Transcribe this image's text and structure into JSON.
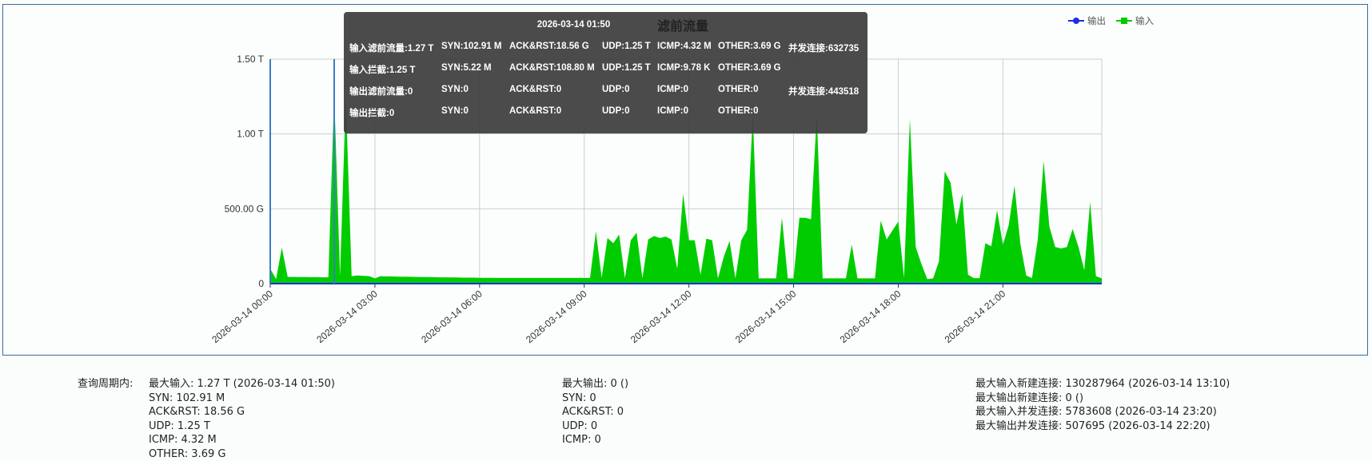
{
  "chart_data": {
    "type": "area",
    "title": "滤前流量",
    "x_start": "2026-03-14 00:00",
    "x_interval_minutes": 10,
    "x_tick_labels": [
      "2026-03-14 00:00",
      "2026-03-14 03:00",
      "2026-03-14 06:00",
      "2026-03-14 09:00",
      "2026-03-14 12:00",
      "2026-03-14 15:00",
      "2026-03-14 18:00",
      "2026-03-14 21:00"
    ],
    "y_unit": "G",
    "y_tick_values": [
      0,
      500,
      1000,
      1500
    ],
    "y_tick_labels": [
      "0",
      "500.00 G",
      "1.00 T",
      "1.50 T"
    ],
    "ylim": [
      0,
      1500
    ],
    "grid": true,
    "legend_position": "top-right",
    "series": [
      {
        "name": "输出",
        "color": "#1f2fe0",
        "marker": "circle",
        "values": "all zero"
      },
      {
        "name": "输入",
        "color": "#00cc00",
        "marker": "square",
        "values": [
          100,
          30,
          240,
          45,
          45,
          44,
          44,
          43,
          43,
          42,
          42,
          1270,
          50,
          1250,
          50,
          55,
          52,
          50,
          35,
          50,
          48,
          48,
          47,
          46,
          46,
          45,
          44,
          44,
          43,
          42,
          42,
          41,
          41,
          40,
          40,
          40,
          39,
          39,
          39,
          38,
          38,
          38,
          38,
          38,
          38,
          38,
          38,
          38,
          38,
          38,
          38,
          38,
          38,
          38,
          38,
          38,
          350,
          40,
          305,
          270,
          328,
          37,
          290,
          340,
          37,
          295,
          318,
          305,
          315,
          295,
          100,
          600,
          290,
          290,
          60,
          300,
          290,
          35,
          180,
          285,
          35,
          290,
          360,
          1130,
          35,
          35,
          35,
          35,
          440,
          35,
          35,
          440,
          440,
          430,
          1130,
          35,
          35,
          35,
          35,
          35,
          260,
          35,
          35,
          35,
          35,
          420,
          295,
          355,
          415,
          40,
          1100,
          245,
          130,
          30,
          35,
          150,
          750,
          675,
          395,
          600,
          60,
          37,
          37,
          270,
          250,
          490,
          260,
          390,
          655,
          265,
          55,
          37,
          295,
          820,
          380,
          245,
          235,
          245,
          365,
          245,
          90,
          545,
          50,
          35
        ]
      }
    ],
    "hover_index": 11
  },
  "legend": {
    "output": "输出",
    "input": "输入"
  },
  "tooltip": {
    "time": "2026-03-14 01:50",
    "rows": [
      [
        "输入滤前流量:1.27 T",
        "SYN:102.91 M",
        "ACK&RST:18.56 G",
        "UDP:1.25 T",
        "ICMP:4.32 M",
        "OTHER:3.69 G",
        "并发连接:632735"
      ],
      [
        "输入拦截:1.25 T",
        "SYN:5.22 M",
        "ACK&RST:108.80 M",
        "UDP:1.25 T",
        "ICMP:9.78 K",
        "OTHER:3.69 G",
        ""
      ],
      [
        "输出滤前流量:0",
        "SYN:0",
        "ACK&RST:0",
        "UDP:0",
        "ICMP:0",
        "OTHER:0",
        "并发连接:443518"
      ],
      [
        "输出拦截:0",
        "SYN:0",
        "ACK&RST:0",
        "UDP:0",
        "ICMP:0",
        "OTHER:0",
        ""
      ]
    ]
  },
  "stats": {
    "period_label": "查询周期内:",
    "input": [
      "最大输入: 1.27 T (2026-03-14 01:50)",
      "SYN: 102.91 M",
      "ACK&RST: 18.56 G",
      "UDP: 1.25 T",
      "ICMP: 4.32 M",
      "OTHER: 3.69 G"
    ],
    "output": [
      "最大输出: 0 ()",
      "SYN: 0",
      "ACK&RST: 0",
      "UDP: 0",
      "ICMP: 0"
    ],
    "connections": [
      "最大输入新建连接: 130287964 (2026-03-14 13:10)",
      "最大输出新建连接: 0 ()",
      "最大输入并发连接: 5783608 (2026-03-14 23:20)",
      "最大输出并发连接: 507695 (2026-03-14 22:20)"
    ]
  }
}
